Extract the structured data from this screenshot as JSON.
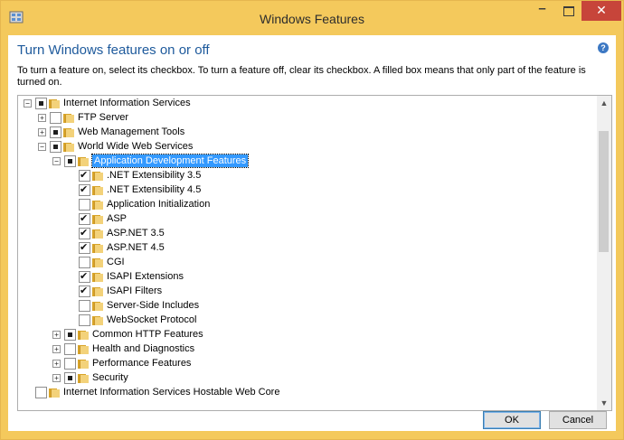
{
  "window": {
    "title": "Windows Features",
    "minimize_label": "–",
    "close_label": "✕"
  },
  "header": {
    "heading": "Turn Windows features on or off",
    "help_label": "?",
    "description": "To turn a feature on, select its checkbox. To turn a feature off, clear its checkbox. A filled box means that only part of the feature is turned on."
  },
  "tree": [
    {
      "label": "Internet Information Services",
      "level": 0,
      "expand": "−",
      "state": "partial",
      "selected": false
    },
    {
      "label": "FTP Server",
      "level": 1,
      "expand": "+",
      "state": "unchecked",
      "selected": false
    },
    {
      "label": "Web Management Tools",
      "level": 1,
      "expand": "+",
      "state": "partial",
      "selected": false
    },
    {
      "label": "World Wide Web Services",
      "level": 1,
      "expand": "−",
      "state": "partial",
      "selected": false
    },
    {
      "label": "Application Development Features",
      "level": 2,
      "expand": "−",
      "state": "partial",
      "selected": true
    },
    {
      "label": ".NET Extensibility 3.5",
      "level": 3,
      "expand": "",
      "state": "checked",
      "selected": false
    },
    {
      "label": ".NET Extensibility 4.5",
      "level": 3,
      "expand": "",
      "state": "checked",
      "selected": false
    },
    {
      "label": "Application Initialization",
      "level": 3,
      "expand": "",
      "state": "unchecked",
      "selected": false
    },
    {
      "label": "ASP",
      "level": 3,
      "expand": "",
      "state": "checked",
      "selected": false
    },
    {
      "label": "ASP.NET 3.5",
      "level": 3,
      "expand": "",
      "state": "checked",
      "selected": false
    },
    {
      "label": "ASP.NET 4.5",
      "level": 3,
      "expand": "",
      "state": "checked",
      "selected": false
    },
    {
      "label": "CGI",
      "level": 3,
      "expand": "",
      "state": "unchecked",
      "selected": false
    },
    {
      "label": "ISAPI Extensions",
      "level": 3,
      "expand": "",
      "state": "checked",
      "selected": false
    },
    {
      "label": "ISAPI Filters",
      "level": 3,
      "expand": "",
      "state": "checked",
      "selected": false
    },
    {
      "label": "Server-Side Includes",
      "level": 3,
      "expand": "",
      "state": "unchecked",
      "selected": false
    },
    {
      "label": "WebSocket Protocol",
      "level": 3,
      "expand": "",
      "state": "unchecked",
      "selected": false
    },
    {
      "label": "Common HTTP Features",
      "level": 2,
      "expand": "+",
      "state": "partial",
      "selected": false
    },
    {
      "label": "Health and Diagnostics",
      "level": 2,
      "expand": "+",
      "state": "unchecked",
      "selected": false
    },
    {
      "label": "Performance Features",
      "level": 2,
      "expand": "+",
      "state": "unchecked",
      "selected": false
    },
    {
      "label": "Security",
      "level": 2,
      "expand": "+",
      "state": "partial",
      "selected": false
    },
    {
      "label": "Internet Information Services Hostable Web Core",
      "level": 0,
      "expand": "",
      "state": "unchecked",
      "selected": false
    }
  ],
  "scrollbar": {
    "up_label": "▲",
    "down_label": "▼"
  },
  "footer": {
    "ok_label": "OK",
    "cancel_label": "Cancel"
  },
  "colors": {
    "title_bar": "#f4c95c",
    "close_button": "#c7453a",
    "heading": "#1e5a9c",
    "selection": "#3399ff",
    "folder": "#f3d27a"
  }
}
